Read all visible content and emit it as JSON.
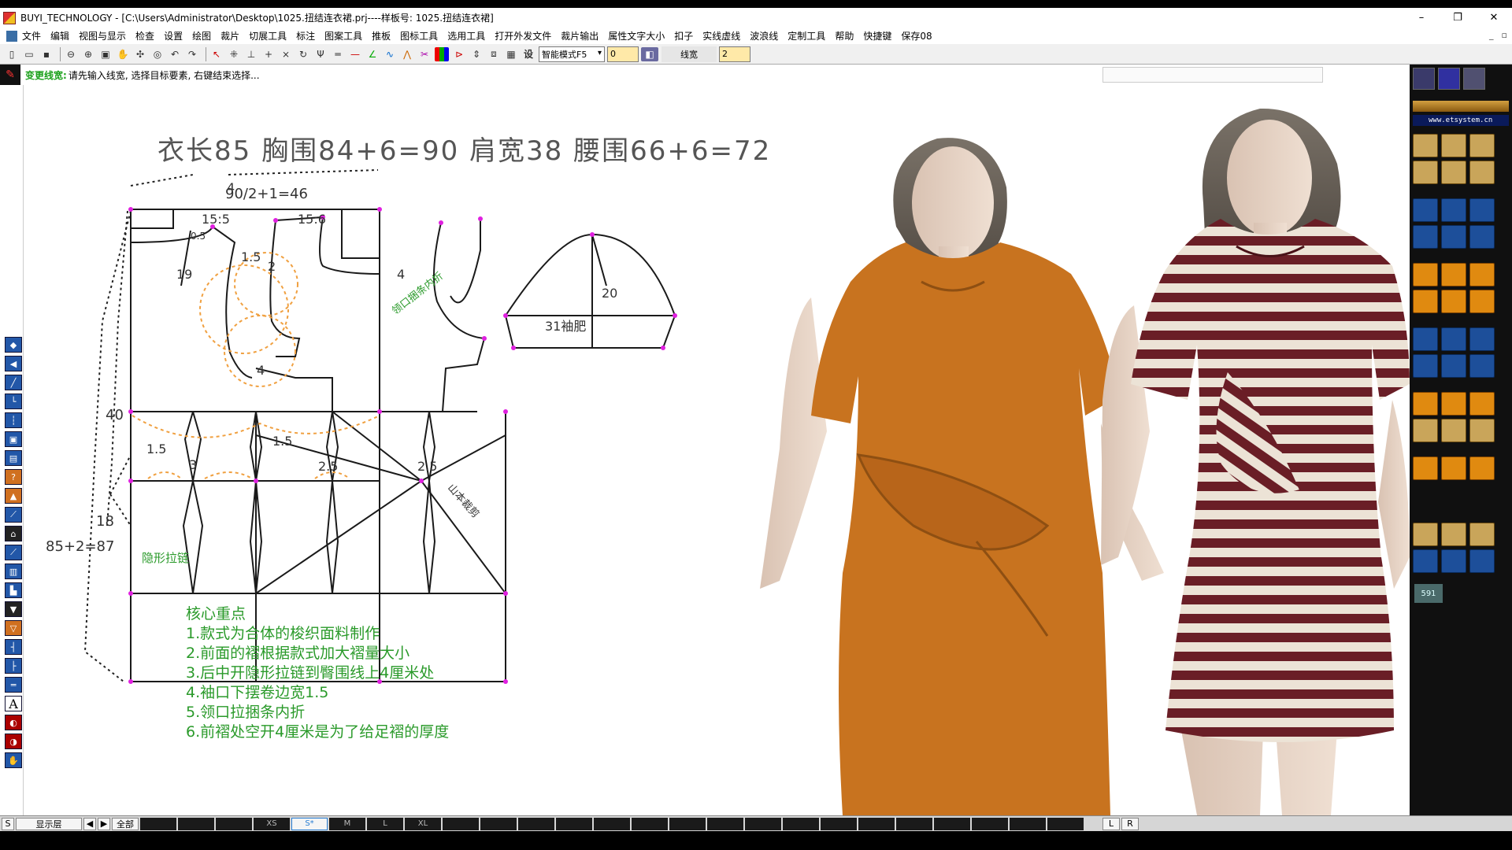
{
  "window": {
    "title": "BUYI_TECHNOLOGY - [C:\\Users\\Administrator\\Desktop\\1025.扭结连衣裙.prj----样板号: 1025.扭结连衣裙]",
    "minimize": "–",
    "restore": "❐",
    "close": "✕"
  },
  "menu": [
    "文件",
    "编辑",
    "视图与显示",
    "检查",
    "设置",
    "绘图",
    "裁片",
    "切展工具",
    "标注",
    "图案工具",
    "推板",
    "图标工具",
    "选用工具",
    "打开外发文件",
    "裁片输出",
    "属性文字大小",
    "扣子",
    "实线虚线",
    "波浪线",
    "定制工具",
    "帮助",
    "快捷键",
    "保存08"
  ],
  "toolbar": {
    "mode_select": "智能模式F5",
    "field_1": "0",
    "linewidth_label": "线宽",
    "field_2": "2"
  },
  "command": {
    "name": "变更线宽:",
    "prompt": "请先输入线宽, 选择目标要素, 右键结束选择..."
  },
  "drawing": {
    "header": "衣长85   胸围84+6=90   肩宽38   腰围66+6=72",
    "labels": {
      "half_bust": "90/2+1=46",
      "top_4": "4",
      "shoulder_front": "15:5",
      "shoulder_back": "15:6",
      "neck_small": "0.5",
      "neck_19": "19",
      "val_15a": "1.5",
      "val_2": "2",
      "val_4_armhole": "4",
      "val_4_neck": "4",
      "neck_facing": "领口捆条内折",
      "sleeve_20": "20",
      "sleeve_width": "31袖肥",
      "val_40": "40",
      "val_15b": "1.5",
      "val_15c": "1.5",
      "val_3": "3",
      "val_25a": "2.5",
      "val_25b": "2.5",
      "val_18": "18",
      "length_total": "85+2=87",
      "zipper": "隐形拉链",
      "pleat": "山本裁剪",
      "notes_title": "核心重点",
      "notes": [
        "1.款式为合体的梭织面料制作",
        "2.前面的褶根据款式加大褶量大小",
        "3.后中开隐形拉链到臀围线上4厘米处",
        "4.袖口下摆卷边宽1.5",
        "5.领口拉捆条内折",
        "6.前褶处空开4厘米是为了给足褶的厚度"
      ]
    },
    "colors": {
      "line": "#1a1a1a",
      "point": "#e020e0",
      "guide": "#f0a040",
      "note_green": "#2a9a2a",
      "dress_orange": "#c8731f",
      "stripe_dark": "#6a1e26",
      "stripe_light": "#ece3d6"
    }
  },
  "right_panel": {
    "site": "www.etsystem.cn",
    "counter": "591"
  },
  "bottom": {
    "layer_s": "S",
    "layer_display": "显示层",
    "prev": "◀",
    "next": "▶",
    "all": "全部",
    "sizes": [
      "XS",
      "S*",
      "M",
      "L",
      "XL"
    ],
    "right_l": "L",
    "right_r": "R"
  }
}
